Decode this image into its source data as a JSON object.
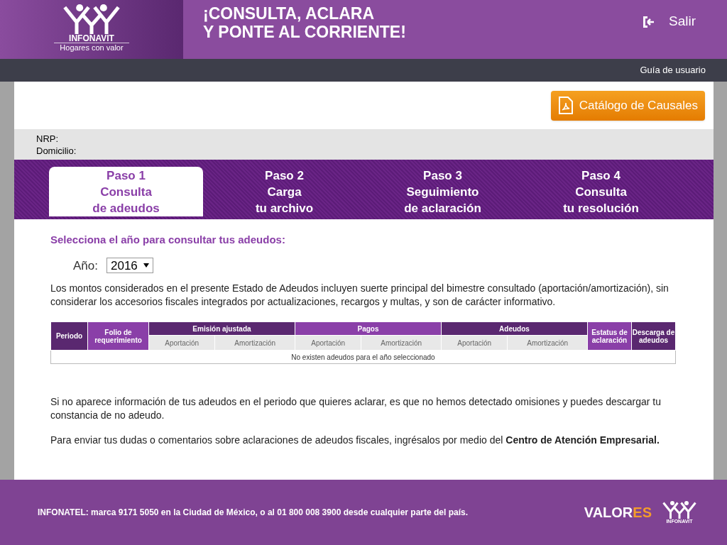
{
  "header": {
    "logo_name": "INFONAVIT",
    "logo_tagline": "Hogares con valor",
    "headline": [
      "¡CONSULTA, ACLARA",
      "Y PONTE AL CORRIENTE!"
    ],
    "logout": "Salir"
  },
  "nav": {
    "guide_link": "Guía de usuario"
  },
  "catalog_button": "Catálogo de Causales",
  "info": [
    {
      "label": "NRP:"
    },
    {
      "label": "Domicilio:"
    }
  ],
  "steps": [
    {
      "lines": [
        "Paso 1",
        "Consulta",
        "de adeudos"
      ],
      "selected": true
    },
    {
      "lines": [
        "Paso 2",
        "Carga",
        "tu archivo"
      ],
      "selected": false
    },
    {
      "lines": [
        "Paso 3",
        "Seguimiento",
        "de aclaración"
      ],
      "selected": false
    },
    {
      "lines": [
        "Paso 4",
        "Consulta",
        "tu resolución"
      ],
      "selected": false
    }
  ],
  "year_section": {
    "heading": "Selecciona el año para consultar tus adeudos:",
    "year_label": "Año:",
    "year_value": "2016"
  },
  "disclaimer": "Los montos considerados en el presente Estado de Adeudos incluyen suerte principal del bimestre consultado (aportación/amortización), sin considerar los accesorios fiscales integrados por actualizaciones, recargos y multas, y son de carácter informativo.",
  "table": {
    "single_columns": [
      "Periodo",
      "Folio de requerimiento"
    ],
    "groups": [
      {
        "label": "Emisión ajustada",
        "subcolumns": [
          "Aportación",
          "Amortización"
        ]
      },
      {
        "label": "Pagos",
        "subcolumns": [
          "Aportación",
          "Amortización"
        ]
      },
      {
        "label": "Adeudos",
        "subcolumns": [
          "Aportación",
          "Amortización"
        ]
      }
    ],
    "trailing_columns": [
      "Estatus de aclaración",
      "Descarga de adeudos"
    ],
    "empty_message": "No existen adeudos para el año seleccionado"
  },
  "notes": [
    "Si no aparece información de tus adeudos en el periodo que quieres aclarar, es que no hemos detectado omisiones y puedes descargar tu constancia de no adeudo.",
    "Para enviar tus dudas o comentarios sobre aclaraciones de adeudos fiscales, ingrésalos por medio del **Centro de Atención Empresarial.**"
  ],
  "footer": {
    "text": "INFONATEL: marca 9171 5050 en la Ciudad de México, o al 01 800 008 3900 desde cualquier parte del país.",
    "brand_main": "VALOR",
    "brand_accent": "ES",
    "logo_name": "INFONAVIT"
  }
}
